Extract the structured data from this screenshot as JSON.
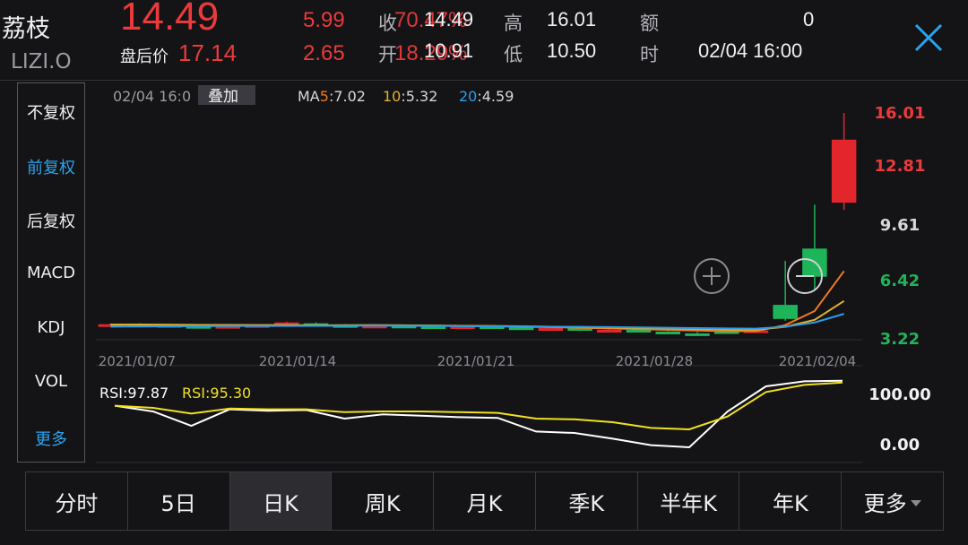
{
  "header": {
    "name": "荔枝",
    "code": "LIZI.O",
    "price": "14.49",
    "after_hours_label": "盘后价",
    "after_hours_price": "17.14",
    "change": "5.99",
    "after_hours_change": "2.65",
    "ghost_change_pct": "70.47%",
    "ghost_after_pct": "18.29%",
    "fields": {
      "close_label": "收",
      "close_value": "14.49",
      "open_label": "开",
      "open_value": "10.91",
      "high_label": "高",
      "high_value": "16.01",
      "low_label": "低",
      "low_value": "10.50",
      "amount_label": "额",
      "amount_value": "0",
      "time_label": "时",
      "time_value": "02/04 16:00"
    }
  },
  "left_menu": {
    "items": [
      "不复权",
      "前复权",
      "后复权",
      "MACD",
      "KDJ",
      "VOL",
      "更多"
    ],
    "active_index": 1,
    "accent_index": 6
  },
  "chart": {
    "timestamp": "02/04 16:0",
    "overlay_label": "叠加",
    "ma": [
      {
        "label": "MA5",
        "value": "7.02",
        "color": "#f07a22"
      },
      {
        "label": "10",
        "value": "5.32",
        "color": "#e3b02a"
      },
      {
        "label": "20",
        "value": "4.59",
        "color": "#2a9de8"
      }
    ],
    "y_labels": [
      {
        "text": "16.01",
        "color": "#ec3a3b"
      },
      {
        "text": "12.81",
        "color": "#ec3a3b"
      },
      {
        "text": "9.61",
        "color": "#d8d8dc"
      },
      {
        "text": "6.42",
        "color": "#23b25a"
      },
      {
        "text": "3.22",
        "color": "#23b25a"
      }
    ],
    "x_labels": [
      "2021/01/07",
      "2021/01/14",
      "2021/01/21",
      "2021/01/28",
      "2021/02/04"
    ],
    "rsi_labels": [
      {
        "label": "RSI:97.87",
        "color": "#ffffff"
      },
      {
        "label": "RSI:95.30",
        "color": "#f0e020"
      }
    ],
    "rsi_axis": [
      "100.00",
      "0.00"
    ]
  },
  "chart_data": {
    "type": "candlestick",
    "price_ylim": [
      3.22,
      16.01
    ],
    "candles": [
      {
        "o": 3.95,
        "h": 4.05,
        "l": 3.9,
        "c": 4.0
      },
      {
        "o": 3.98,
        "h": 4.05,
        "l": 3.9,
        "c": 3.95
      },
      {
        "o": 3.96,
        "h": 4.02,
        "l": 3.88,
        "c": 3.9
      },
      {
        "o": 3.9,
        "h": 3.95,
        "l": 3.8,
        "c": 3.82
      },
      {
        "o": 3.82,
        "h": 3.92,
        "l": 3.8,
        "c": 3.9
      },
      {
        "o": 3.9,
        "h": 4.0,
        "l": 3.85,
        "c": 3.95
      },
      {
        "o": 3.95,
        "h": 4.15,
        "l": 3.9,
        "c": 4.1
      },
      {
        "o": 4.05,
        "h": 4.1,
        "l": 3.9,
        "c": 3.95
      },
      {
        "o": 3.95,
        "h": 4.0,
        "l": 3.85,
        "c": 3.9
      },
      {
        "o": 3.9,
        "h": 3.98,
        "l": 3.82,
        "c": 3.92
      },
      {
        "o": 3.92,
        "h": 3.96,
        "l": 3.85,
        "c": 3.88
      },
      {
        "o": 3.88,
        "h": 3.92,
        "l": 3.82,
        "c": 3.86
      },
      {
        "o": 3.86,
        "h": 3.95,
        "l": 3.8,
        "c": 3.88
      },
      {
        "o": 3.88,
        "h": 3.92,
        "l": 3.8,
        "c": 3.82
      },
      {
        "o": 3.82,
        "h": 3.86,
        "l": 3.72,
        "c": 3.75
      },
      {
        "o": 3.75,
        "h": 3.82,
        "l": 3.7,
        "c": 3.78
      },
      {
        "o": 3.78,
        "h": 3.8,
        "l": 3.62,
        "c": 3.65
      },
      {
        "o": 3.65,
        "h": 3.72,
        "l": 3.58,
        "c": 3.68
      },
      {
        "o": 3.68,
        "h": 3.7,
        "l": 3.55,
        "c": 3.58
      },
      {
        "o": 3.58,
        "h": 3.6,
        "l": 3.45,
        "c": 3.48
      },
      {
        "o": 3.48,
        "h": 3.55,
        "l": 3.4,
        "c": 3.42
      },
      {
        "o": 3.6,
        "h": 3.7,
        "l": 3.5,
        "c": 3.55
      },
      {
        "o": 3.6,
        "h": 3.7,
        "l": 3.5,
        "c": 3.65
      },
      {
        "o": 5.1,
        "h": 7.6,
        "l": 4.2,
        "c": 4.3
      },
      {
        "o": 8.3,
        "h": 10.8,
        "l": 5.95,
        "c": 6.7
      },
      {
        "o": 10.91,
        "h": 16.01,
        "l": 10.5,
        "c": 14.49
      }
    ],
    "ma_series": [
      {
        "name": "MA5",
        "values": [
          3.97,
          3.97,
          3.96,
          3.95,
          3.94,
          3.93,
          3.93,
          3.93,
          3.94,
          3.95,
          3.94,
          3.92,
          3.9,
          3.88,
          3.86,
          3.83,
          3.8,
          3.76,
          3.72,
          3.68,
          3.64,
          3.6,
          3.61,
          3.95,
          4.75,
          7.02
        ]
      },
      {
        "name": "10",
        "values": [
          3.98,
          3.98,
          3.97,
          3.96,
          3.96,
          3.95,
          3.95,
          3.94,
          3.94,
          3.94,
          3.93,
          3.92,
          3.91,
          3.9,
          3.88,
          3.86,
          3.84,
          3.81,
          3.78,
          3.76,
          3.73,
          3.7,
          3.69,
          3.85,
          4.25,
          5.32
        ]
      },
      {
        "name": "20",
        "values": [
          3.86,
          3.87,
          3.88,
          3.89,
          3.9,
          3.9,
          3.9,
          3.91,
          3.91,
          3.92,
          3.91,
          3.9,
          3.89,
          3.88,
          3.87,
          3.86,
          3.85,
          3.84,
          3.82,
          3.8,
          3.78,
          3.76,
          3.75,
          3.86,
          4.1,
          4.59
        ]
      }
    ],
    "rsi_series": [
      {
        "name": "RSI",
        "values": [
          63,
          55,
          35,
          58,
          56,
          57,
          45,
          51,
          49,
          47,
          46,
          27,
          25,
          17,
          8,
          5,
          55,
          90,
          97,
          97.87
        ]
      },
      {
        "name": "RSI",
        "values": [
          63,
          60,
          52,
          59,
          58,
          58,
          54,
          55,
          55,
          54,
          53,
          45,
          44,
          40,
          32,
          30,
          48,
          82,
          92,
          95.3
        ]
      }
    ],
    "rsi_ylim": [
      0,
      100
    ]
  },
  "bottom_bar": {
    "items": [
      "分时",
      "5日",
      "日K",
      "周K",
      "月K",
      "季K",
      "半年K",
      "年K",
      "更多"
    ],
    "active_index": 2
  }
}
